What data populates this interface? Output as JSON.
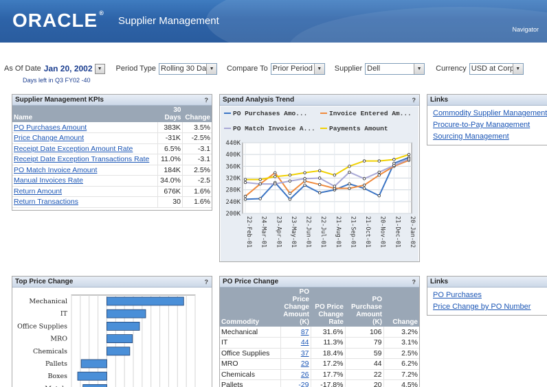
{
  "header": {
    "logo": "ORACLE",
    "app_title": "Supplier Management",
    "navigator": "Navigator"
  },
  "params": {
    "as_of_label": "As Of Date",
    "as_of_value": "Jan 20, 2002",
    "period_type_label": "Period Type",
    "period_type_value": "Rolling 30 Da",
    "compare_to_label": "Compare To",
    "compare_to_value": "Prior Period",
    "supplier_label": "Supplier",
    "supplier_value": "Dell",
    "currency_label": "Currency",
    "currency_value": "USD at Corpc",
    "days_left": "Days left in Q3 FY02 -40"
  },
  "kpis": {
    "title": "Supplier Management KPIs",
    "help": "?",
    "col_name": "Name",
    "col_days_top": "30",
    "col_days_bottom": "Days",
    "col_change": "Change",
    "rows": [
      {
        "name": "PO Purchases Amount",
        "days": "383K",
        "change": "3.5%"
      },
      {
        "name": "Price Change Amount",
        "days": "-31K",
        "change": "-2.5%"
      },
      {
        "name": "Receipt Date Exception Amount Rate",
        "days": "6.5%",
        "change": "-3.1"
      },
      {
        "name": "Receipt Date Exception Transactions Rate",
        "days": "11.0%",
        "change": "-3.1"
      },
      {
        "name": "PO Match Invoice Amount",
        "days": "184K",
        "change": "2.5%"
      },
      {
        "name": "Manual Invoices Rate",
        "days": "34.0%",
        "change": "-2.5"
      },
      {
        "name": "Return Amount",
        "days": "676K",
        "change": "1.6%"
      },
      {
        "name": "Return Transactions",
        "days": "30",
        "change": "1.6%"
      }
    ]
  },
  "spend": {
    "title": "Spend Analysis Trend",
    "help": "?",
    "legend": [
      "PO Purchases Amo...",
      "Invoice Entered Am...",
      "PO Match Invoice A...",
      "Payments Amount"
    ]
  },
  "links1": {
    "title": "Links",
    "items": [
      "Commodity Supplier Management",
      "Procure-to-Pay Management",
      "Sourcing Management"
    ]
  },
  "top_price": {
    "title": "Top Price Change",
    "help": "?"
  },
  "po_price": {
    "title": "PO Price Change",
    "help": "?",
    "headers": [
      "Commodity",
      "PO Price Change Amount (K)",
      "PO Price Change Rate",
      "PO Purchase Amount (K)",
      "Change"
    ],
    "rows": [
      {
        "commodity": "Mechanical",
        "amount": "87",
        "rate": "31.6%",
        "purchase": "106",
        "change": "3.2%"
      },
      {
        "commodity": "IT",
        "amount": "44",
        "rate": "11.3%",
        "purchase": "79",
        "change": "3.1%"
      },
      {
        "commodity": "Office Supplies",
        "amount": "37",
        "rate": "18.4%",
        "purchase": "59",
        "change": "2.5%"
      },
      {
        "commodity": "MRO",
        "amount": "29",
        "rate": "17.2%",
        "purchase": "44",
        "change": "6.2%"
      },
      {
        "commodity": "Chemicals",
        "amount": "26",
        "rate": "17.7%",
        "purchase": "22",
        "change": "7.2%"
      },
      {
        "commodity": "Pallets",
        "amount": "-29",
        "rate": "-17.8%",
        "purchase": "20",
        "change": "4.5%"
      }
    ]
  },
  "links2": {
    "title": "Links",
    "items": [
      "PO Purchases",
      "Price Change by PO Number"
    ]
  },
  "chart_data": [
    {
      "type": "line",
      "x": [
        "22-Feb-01",
        "24-Mar-01",
        "23-Apr-01",
        "23-May-01",
        "22-Jun-01",
        "22-Jul-01",
        "21-Aug-01",
        "21-Sep-01",
        "21-Oct-01",
        "20-Nov-01",
        "21-Dec-01",
        "20-Jan-02"
      ],
      "yticks": [
        "200K",
        "240K",
        "280K",
        "320K",
        "360K",
        "400K",
        "440K"
      ],
      "ylim": [
        200,
        440
      ],
      "grid": true,
      "series": [
        {
          "name": "PO Purchases Amount",
          "color": "#3b74c4",
          "values": [
            248,
            250,
            305,
            248,
            296,
            270,
            280,
            300,
            285,
            260,
            370,
            390
          ]
        },
        {
          "name": "Invoice Entered Amount",
          "color": "#f08a3c",
          "values": [
            258,
            300,
            338,
            268,
            310,
            298,
            285,
            285,
            296,
            330,
            360,
            380
          ]
        },
        {
          "name": "PO Match Invoice Amount",
          "color": "#a8a8d6",
          "values": [
            305,
            300,
            300,
            310,
            318,
            320,
            292,
            340,
            318,
            340,
            363,
            385
          ]
        },
        {
          "name": "Payments Amount",
          "color": "#f0d000",
          "values": [
            315,
            315,
            325,
            330,
            338,
            345,
            330,
            360,
            378,
            378,
            383,
            400
          ]
        }
      ]
    },
    {
      "type": "bar",
      "categories": [
        "Mechanical",
        "IT",
        "Office Supplies",
        "MRO",
        "Chemicals",
        "Pallets",
        "Boxes",
        "Metals"
      ],
      "values": [
        87,
        44,
        37,
        29,
        26,
        -29,
        -33,
        -27
      ]
    }
  ]
}
